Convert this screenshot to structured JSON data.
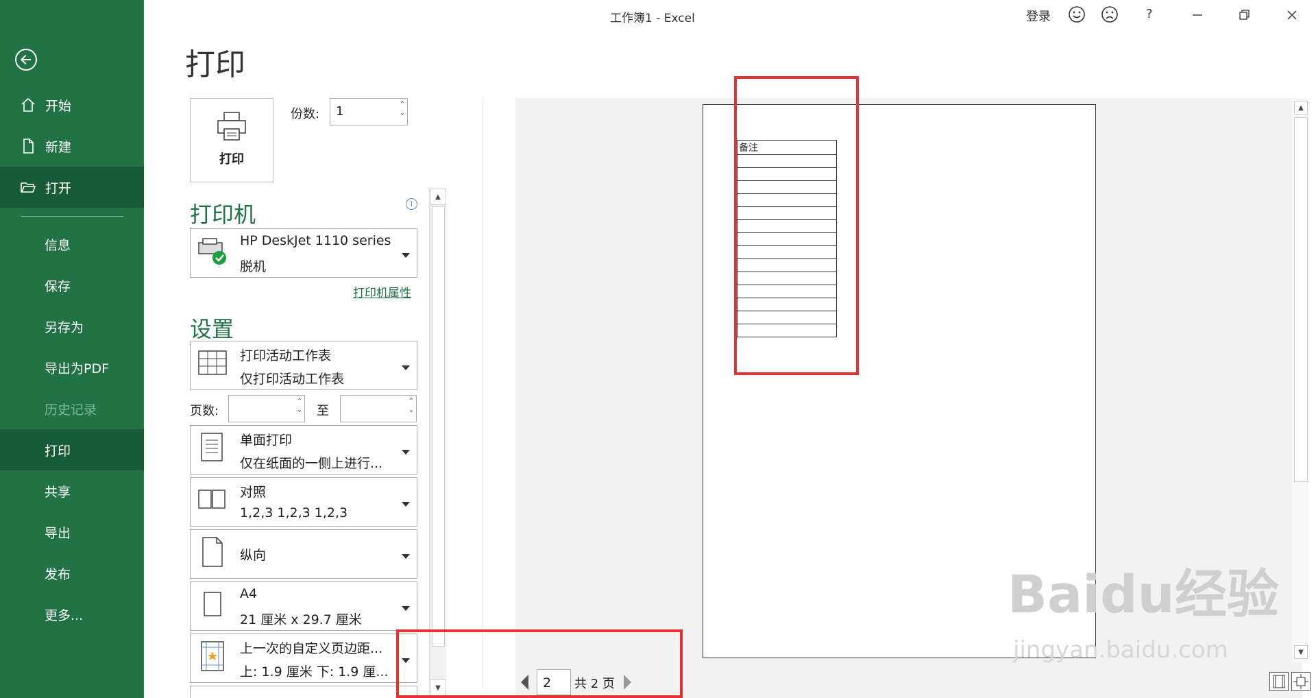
{
  "window": {
    "title": "工作簿1  -  Excel",
    "login": "登录",
    "help": "?"
  },
  "sidebar": {
    "items": [
      {
        "label": "开始"
      },
      {
        "label": "新建"
      },
      {
        "label": "打开"
      },
      {
        "label": "信息"
      },
      {
        "label": "保存"
      },
      {
        "label": "另存为"
      },
      {
        "label": "导出为PDF"
      },
      {
        "label": "历史记录"
      },
      {
        "label": "打印"
      },
      {
        "label": "共享"
      },
      {
        "label": "导出"
      },
      {
        "label": "发布"
      },
      {
        "label": "更多..."
      }
    ]
  },
  "print": {
    "page_title": "打印",
    "button_label": "打印",
    "copies_label": "份数:",
    "copies_value": "1",
    "printer_heading": "打印机",
    "printer_name": "HP DeskJet 1110 series",
    "printer_status": "脱机",
    "printer_properties": "打印机属性",
    "settings_heading": "设置",
    "what_line1": "打印活动工作表",
    "what_line2": "仅打印活动工作表",
    "pages_label": "页数:",
    "to_label": "至",
    "sides_line1": "单面打印",
    "sides_line2": "仅在纸面的一侧上进行...",
    "collate_line1": "对照",
    "collate_line2": "1,2,3    1,2,3    1,2,3",
    "orientation": "纵向",
    "paper_line1": "A4",
    "paper_line2": "21 厘米 x 29.7 厘米",
    "margins_line1": "上一次的自定义页边距...",
    "margins_line2": "上: 1.9 厘米 下: 1.9 厘..."
  },
  "preview": {
    "sheet_header": "备注",
    "current_page": "2",
    "total_pages": "共 2 页"
  },
  "watermark": {
    "brand": "Baidu经验",
    "url": "jingyan.baidu.com"
  }
}
